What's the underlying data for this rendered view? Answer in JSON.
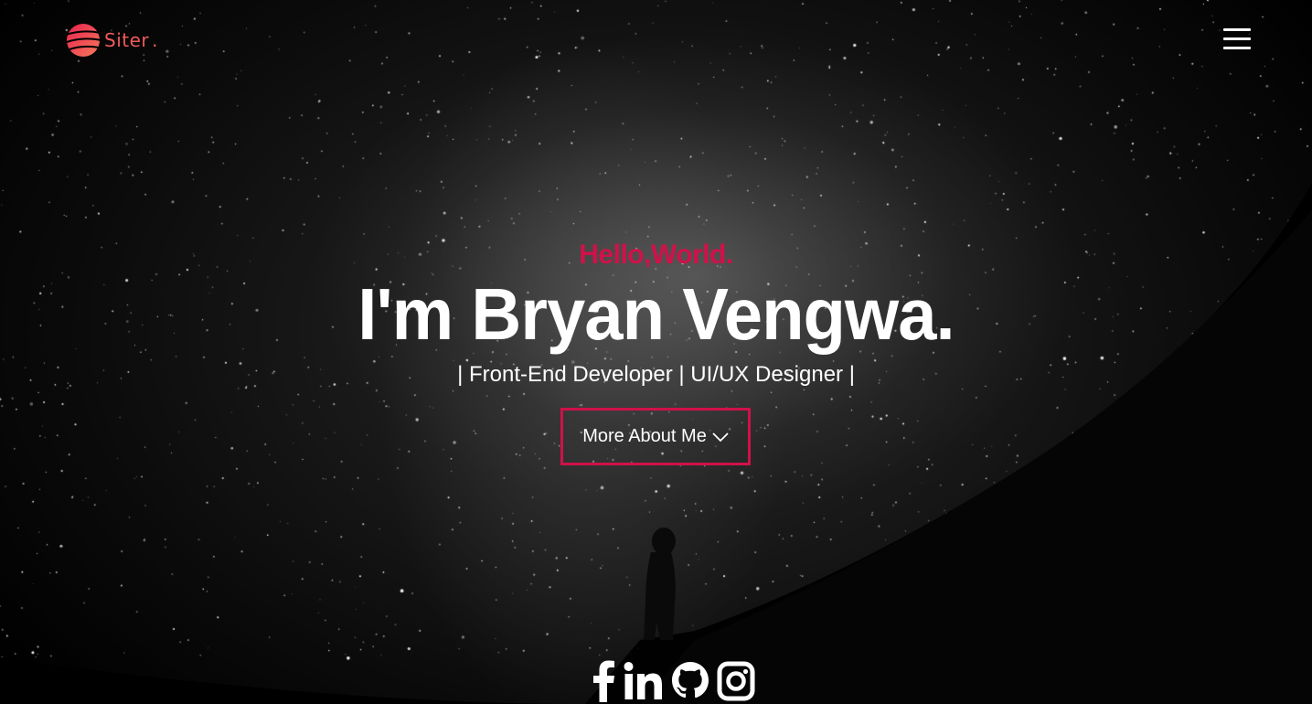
{
  "header": {
    "logo_text": "Siter",
    "logo_dot": ".",
    "menu_icon": "hamburger-menu-icon"
  },
  "hero": {
    "greeting": "Hello,World.",
    "name": "I'm Bryan Vengwa.",
    "roles": "| Front-End Developer | UI/UX Designer |",
    "cta_label": "More About Me",
    "cta_icon": "chevron-down-icon"
  },
  "socials": [
    {
      "name": "facebook",
      "icon": "facebook-icon"
    },
    {
      "name": "linkedin",
      "icon": "linkedin-icon"
    },
    {
      "name": "github",
      "icon": "github-icon"
    },
    {
      "name": "instagram",
      "icon": "instagram-icon"
    }
  ],
  "colors": {
    "accent": "#d0114a",
    "logo": "#f05a5a",
    "background": "#000000",
    "text": "#ffffff"
  }
}
